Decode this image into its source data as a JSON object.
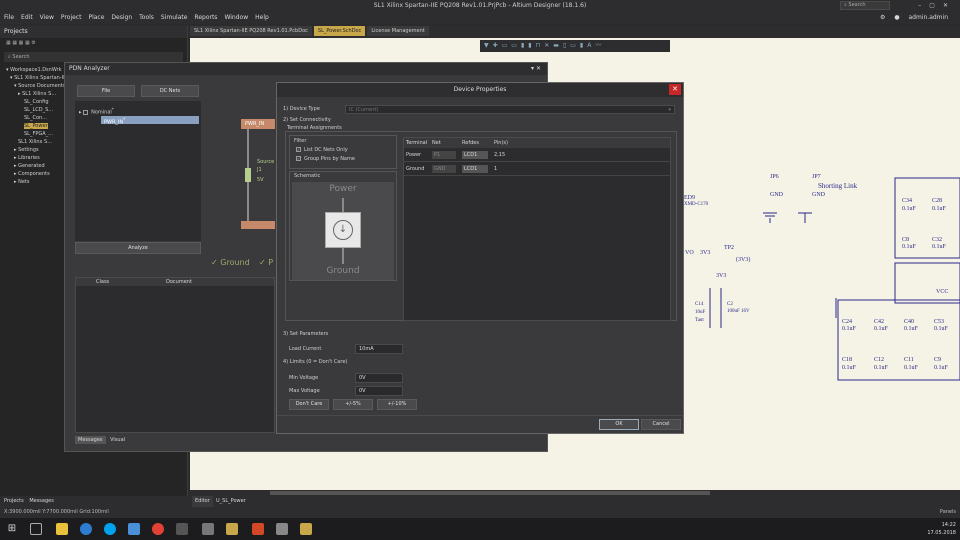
{
  "window": {
    "title": "SL1 Xilinx Spartan-IIE PQ208 Rev1.01.PrjPcb - Altium Designer (18.1.6)",
    "search_placeholder": "Search",
    "user": "admin.admin"
  },
  "menu": [
    "File",
    "Edit",
    "View",
    "Project",
    "Place",
    "Design",
    "Tools",
    "Simulate",
    "Reports",
    "Window",
    "Help"
  ],
  "projects_panel": {
    "title": "Projects",
    "search_placeholder": "Search",
    "tree": [
      "Workspace1.DsnWrk",
      "SL1 Xilinx Spartan-IIE",
      "Source Documents",
      "SL1 Xilinx S...",
      "SL_Config",
      "SL_LCD_S...",
      "SL_Con...",
      "SL_Power",
      "SL_FPGA_...",
      "SL1 Xilinx S...",
      "Settings",
      "Libraries",
      "Generated",
      "Components",
      "Nets"
    ]
  },
  "tabs": [
    "SL1 Xilinx Spartan-IIE PQ208 Rev1.01.PcbDoc",
    "SL_Power.SchDoc",
    "License Management"
  ],
  "pdn": {
    "title": "PDN Analyzer",
    "file_btn": "File",
    "dcnets_btn": "DC Nets",
    "nominal": "Nominal",
    "net": "PWR_IN",
    "analyze": "Analyze",
    "col_class": "Class",
    "col_document": "Document",
    "bottom_tabs": [
      "Messages",
      "Visual"
    ],
    "diagram": {
      "net_box": "PWR_IN",
      "source": "Source",
      "ref": "J1",
      "volts": "5V",
      "ground": "Ground",
      "p": "P"
    }
  },
  "device_props": {
    "title": "Device Properties",
    "step1": "1) Device Type",
    "device_type": "IC (Current)",
    "step2": "2) Set Connectivity",
    "terminal_assignments": "Terminal Assignments",
    "filter": "Filter",
    "list_dc_only": "List DC Nets Only",
    "group_pins": "Group Pins by Name",
    "schematic": "Schematic",
    "power": "Power",
    "ground": "Ground",
    "table_headers": [
      "Terminal",
      "Net",
      "Refdes",
      "Pin(s)"
    ],
    "rows": [
      {
        "terminal": "Power",
        "net": "P1",
        "refdes": "LCD1",
        "pins": "2,15"
      },
      {
        "terminal": "Ground",
        "net": "GND",
        "refdes": "LCD1",
        "pins": "1"
      }
    ],
    "step3": "3) Set Parameters",
    "load_current_label": "Load Current",
    "load_current": "10mA",
    "step4": "4) Limits (0 = Don't Care)",
    "min_voltage_label": "Min Voltage",
    "min_voltage": "0V",
    "max_voltage_label": "Max Voltage",
    "max_voltage": "0V",
    "dont_care": "Don't Care",
    "pm5": "+/-5%",
    "pm10": "+/-10%",
    "ok": "OK",
    "cancel": "Cancel"
  },
  "schematic_labels": {
    "jp6": "JP6",
    "gnd1": "GND",
    "jp7": "JP7",
    "gnd2": "GND",
    "shorting_link": "Shorting Link",
    "tp2": "TP2",
    "v3v3a": "3V3",
    "v3v3b": "(3V3)",
    "v3v3c": "3V3",
    "c14": "C14",
    "c14v": "10uF",
    "tant": "Tant",
    "c2": "C2",
    "c2v": "100uF 16V",
    "c34": "C34",
    "c28": "C28",
    "c8": "C8",
    "c32": "C32",
    "c24": "C24",
    "c42": "C42",
    "c40": "C40",
    "c53": "C53",
    "c18": "C18",
    "c12": "C12",
    "c11": "C11",
    "c9": "C9",
    "cap": "0.1uF",
    "vcc": "VCC",
    "ed9": "ED9",
    "xmd": "XMD-C170",
    "vo": "VO"
  },
  "bottom_tabs": [
    "Projects",
    "Messages"
  ],
  "editor_tabs": [
    "Editor",
    "U_SL_Power"
  ],
  "status": {
    "coords": "X:3900.000mil Y:7700.000mil   Grid:100mil",
    "panels": "Panels"
  },
  "clock": {
    "time": "14:22",
    "date": "17.05.2018"
  }
}
